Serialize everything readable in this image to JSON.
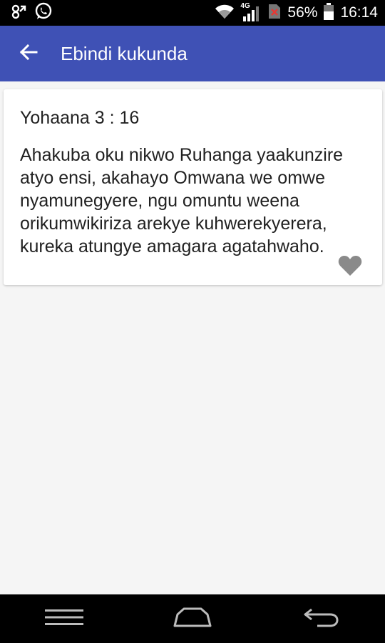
{
  "status_bar": {
    "battery_percent": "56%",
    "time": "16:14",
    "network": "4G",
    "icons": [
      "sync-icon",
      "whatsapp-icon",
      "wifi-icon",
      "signal-icon",
      "no-sim-icon",
      "battery-icon"
    ]
  },
  "app_bar": {
    "title": "Ebindi kukunda",
    "back_icon": "arrow-back-icon",
    "color": "#3f51b5"
  },
  "favorites": [
    {
      "reference": "Yohaana 3 : 16",
      "text": "Ahakuba oku nikwo Ruhanga yaakunzire atyo ensi, akahayo Omwana we omwe nyamunegyere, ngu omuntu weena orikumwikiriza arekye kuhwerekyerera, kureka atungye amagara agatahwaho.",
      "action_icon": "heart-icon"
    }
  ],
  "nav_bar": {
    "icons": [
      "menu-icon",
      "home-icon",
      "back-icon"
    ]
  }
}
